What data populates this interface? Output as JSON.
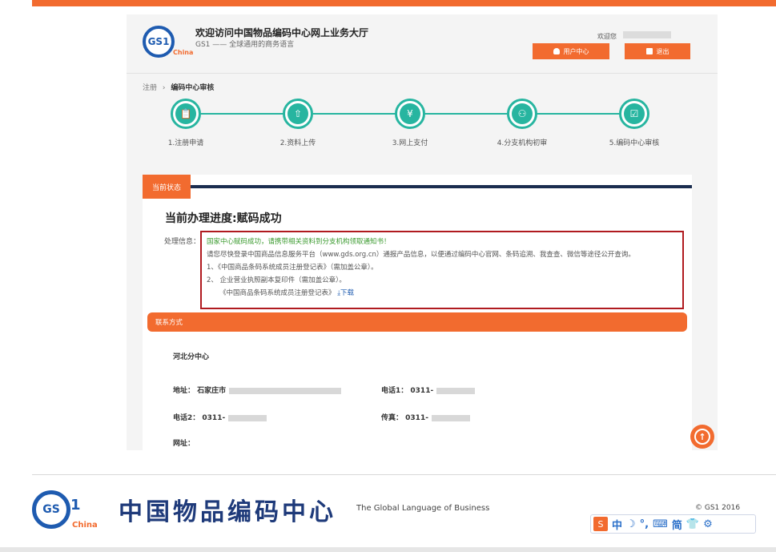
{
  "header": {
    "logo_text": "GS1",
    "logo_sub": "China",
    "title": "欢迎访问中国物品编码中心网上业务大厅",
    "subtitle": "GS1 —— 全球通用的商务语言",
    "welcome": "欢迎您",
    "user_center_label": "用户中心",
    "exit_label": "退出"
  },
  "breadcrumb": {
    "first": "注册",
    "sep": "›",
    "current": "编码中心审核"
  },
  "steps": [
    {
      "label": "1.注册申请",
      "icon": "📋"
    },
    {
      "label": "2.资料上传",
      "icon": "⇧"
    },
    {
      "label": "3.网上支付",
      "icon": "¥"
    },
    {
      "label": "4.分支机构初审",
      "icon": "⚇"
    },
    {
      "label": "5.编码中心审核",
      "icon": "☑"
    }
  ],
  "status": {
    "tab_label": "当前状态",
    "progress_title": "当前办理进度:赋码成功",
    "info_label": "处理信息：",
    "line1": "国家中心赋码成功，请携带相关资料到分支机构领取通知书！",
    "line2": "请您尽快登录中国商品信息服务平台（www.gds.org.cn）通报产品信息，以便通过编码中心官网、条码追溯、我查查、微信等途径公开查询。",
    "line3": "1、《中国商品条码系统成员注册登记表》（需加盖公章）。",
    "line4": "2、 企业营业执照副本复印件（需加盖公章）。",
    "line5": "《中国商品条码系统成员注册登记表》",
    "download": "⤓下载"
  },
  "contact": {
    "bar_label": "联系方式",
    "branch": "河北分中心",
    "address_label": "地址：",
    "address_value": "石家庄市",
    "phone1_label": "电话1：",
    "phone1_value": "0311-",
    "phone2_label": "电话2：",
    "phone2_value": "0311-",
    "fax_label": "传真：",
    "fax_value": "0311-",
    "site_label": "网址："
  },
  "footer": {
    "logo_text": "GS",
    "logo_one": "1",
    "logo_china": "China",
    "cn_name": "中国物品编码中心",
    "tagline": "The Global Language of Business",
    "copyright": "© GS1 2016"
  },
  "toolbar": {
    "items": [
      "中",
      "☽",
      "°,",
      "⌨",
      "简",
      "👕",
      "⚙"
    ]
  },
  "colors": {
    "accent": "#f26b2f",
    "teal": "#27b5a0",
    "navy": "#1b2d4f",
    "alert_border": "#b01a1f"
  }
}
